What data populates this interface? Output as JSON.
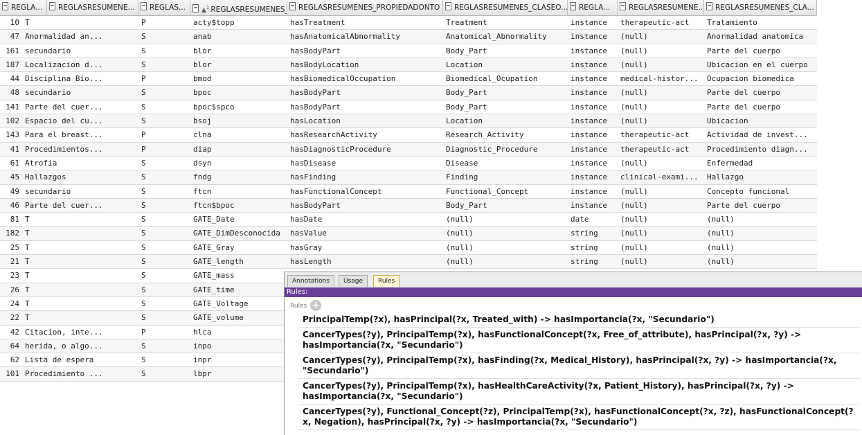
{
  "grid": {
    "headers": [
      "REGLA...",
      "REGLASRESUMENE...",
      "REGLAS...",
      "REGLASRESUMENES_S...",
      "REGLASRESUMENES_PROPIEDADONTO",
      "REGLASRESUMENES_CLASEO...",
      "REGLA...",
      "REGLASRESUMENE...",
      "REGLASRESUMENES_CLA..."
    ],
    "rows": [
      [
        "10",
        "T",
        "P",
        "acty$topp",
        "hasTreatment",
        "Treatment",
        "instance",
        "therapeutic-act",
        "Tratamiento"
      ],
      [
        "47",
        "Anormalidad an...",
        "S",
        "anab",
        "hasAnatomicalAbnormality",
        "Anatomical_Abnormality",
        "instance",
        "(null)",
        "Anormalidad anatomica"
      ],
      [
        "161",
        "secundario",
        "S",
        "blor",
        "hasBodyPart",
        "Body_Part",
        "instance",
        "(null)",
        "Parte del cuerpo"
      ],
      [
        "187",
        "Localizacion d...",
        "S",
        "blor",
        "hasBodyLocation",
        "Location",
        "instance",
        "(null)",
        "Ubicacion en el cuerpo"
      ],
      [
        "44",
        "Disciplina Bio...",
        "P",
        "bmod",
        "hasBiomedicalOccupation",
        "Biomedical_Ocupation",
        "instance",
        "medical-histor...",
        "Ocupacion biomedica"
      ],
      [
        "48",
        "secundario",
        "S",
        "bpoc",
        "hasBodyPart",
        "Body_Part",
        "instance",
        "(null)",
        "Parte del cuerpo"
      ],
      [
        "141",
        "Parte del cuer...",
        "S",
        "bpoc$spco",
        "hasBodyPart",
        "Body_Part",
        "instance",
        "(null)",
        "Parte del cuerpo"
      ],
      [
        "102",
        "Espacio del cu...",
        "S",
        "bsoj",
        "hasLocation",
        "Location",
        "instance",
        "(null)",
        "Ubicacion"
      ],
      [
        "143",
        "Para el breast...",
        "P",
        "clna",
        "hasResearchActivity",
        "Research_Activity",
        "instance",
        "therapeutic-act",
        "Actividad de invest..."
      ],
      [
        "41",
        "Procedimientos...",
        "P",
        "diap",
        "hasDiagnosticProcedure",
        "Diagnostic_Procedure",
        "instance",
        "therapeutic-act",
        "Procedimiento diagn..."
      ],
      [
        "61",
        "Atrofia",
        "S",
        "dsyn",
        "hasDisease",
        "Disease",
        "instance",
        "(null)",
        "Enfermedad"
      ],
      [
        "45",
        "Hallazgos",
        "S",
        "fndg",
        "hasFinding",
        "Finding",
        "instance",
        "clinical-exami...",
        "Hallazgo"
      ],
      [
        "49",
        "secundario",
        "S",
        "ftcn",
        "hasFunctionalConcept",
        "Functional_Concept",
        "instance",
        "(null)",
        "Concepto funcional"
      ],
      [
        "46",
        "Parte del cuer...",
        "S",
        "ftcn$bpoc",
        "hasBodyPart",
        "Body_Part",
        "instance",
        "(null)",
        "Parte del cuerpo"
      ],
      [
        "81",
        "T",
        "S",
        "GATE_Date",
        "hasDate",
        "(null)",
        "date",
        "(null)",
        "(null)"
      ],
      [
        "182",
        "T",
        "S",
        "GATE_DimDesconocida",
        "hasValue",
        "(null)",
        "string",
        "(null)",
        "(null)"
      ],
      [
        "25",
        "T",
        "S",
        "GATE_Gray",
        "hasGray",
        "(null)",
        "string",
        "(null)",
        "(null)"
      ],
      [
        "21",
        "T",
        "S",
        "GATE_length",
        "hasLength",
        "(null)",
        "string",
        "(null)",
        "(null)"
      ],
      [
        "23",
        "T",
        "S",
        "GATE_mass",
        "",
        "",
        "",
        "",
        ""
      ],
      [
        "26",
        "T",
        "S",
        "GATE_time",
        "",
        "",
        "",
        "",
        ""
      ],
      [
        "24",
        "T",
        "S",
        "GATE_Voltage",
        "",
        "",
        "",
        "",
        ""
      ],
      [
        "22",
        "T",
        "S",
        "GATE_volume",
        "",
        "",
        "",
        "",
        ""
      ],
      [
        "42",
        "Citacion, inte...",
        "P",
        "hlca",
        "",
        "",
        "",
        "",
        ""
      ],
      [
        "64",
        "herida, o algo...",
        "S",
        "inpo",
        "",
        "",
        "",
        "",
        ""
      ],
      [
        "62",
        "Lista de espera",
        "S",
        "inpr",
        "",
        "",
        "",
        "",
        ""
      ],
      [
        "101",
        "Procedimiento ...",
        "S",
        "lbpr",
        "",
        "",
        "",
        "",
        ""
      ]
    ]
  },
  "panel": {
    "tabs": [
      "Annotations",
      "Usage",
      "Rules"
    ],
    "active_tab": "Rules",
    "title": "Rules:",
    "rules_label": "Rules",
    "rules": [
      "PrincipalTemp(?x), hasPrincipal(?x, Treated_with) -> hasImportancia(?x, \"Secundario\")",
      "CancerTypes(?y), PrincipalTemp(?x), hasFunctionalConcept(?x, Free_of_attribute), hasPrincipal(?x, ?y) -> hasImportancia(?x, \"Secundario\")",
      "CancerTypes(?y), PrincipalTemp(?x), hasFinding(?x, Medical_History), hasPrincipal(?x, ?y) -> hasImportancia(?x, \"Secundario\")",
      "CancerTypes(?y), PrincipalTemp(?x), hasHealthCareActivity(?x, Patient_History), hasPrincipal(?x, ?y) -> hasImportancia(?x, \"Secundario\")",
      "CancerTypes(?y), Functional_Concept(?z), PrincipalTemp(?x), hasFunctionalConcept(?x, ?z), hasFunctionalConcept(?x, Negation), hasPrincipal(?x, ?y) -> hasImportancia(?x, \"Secundario\")"
    ],
    "accent_color": "#6a3d99"
  }
}
